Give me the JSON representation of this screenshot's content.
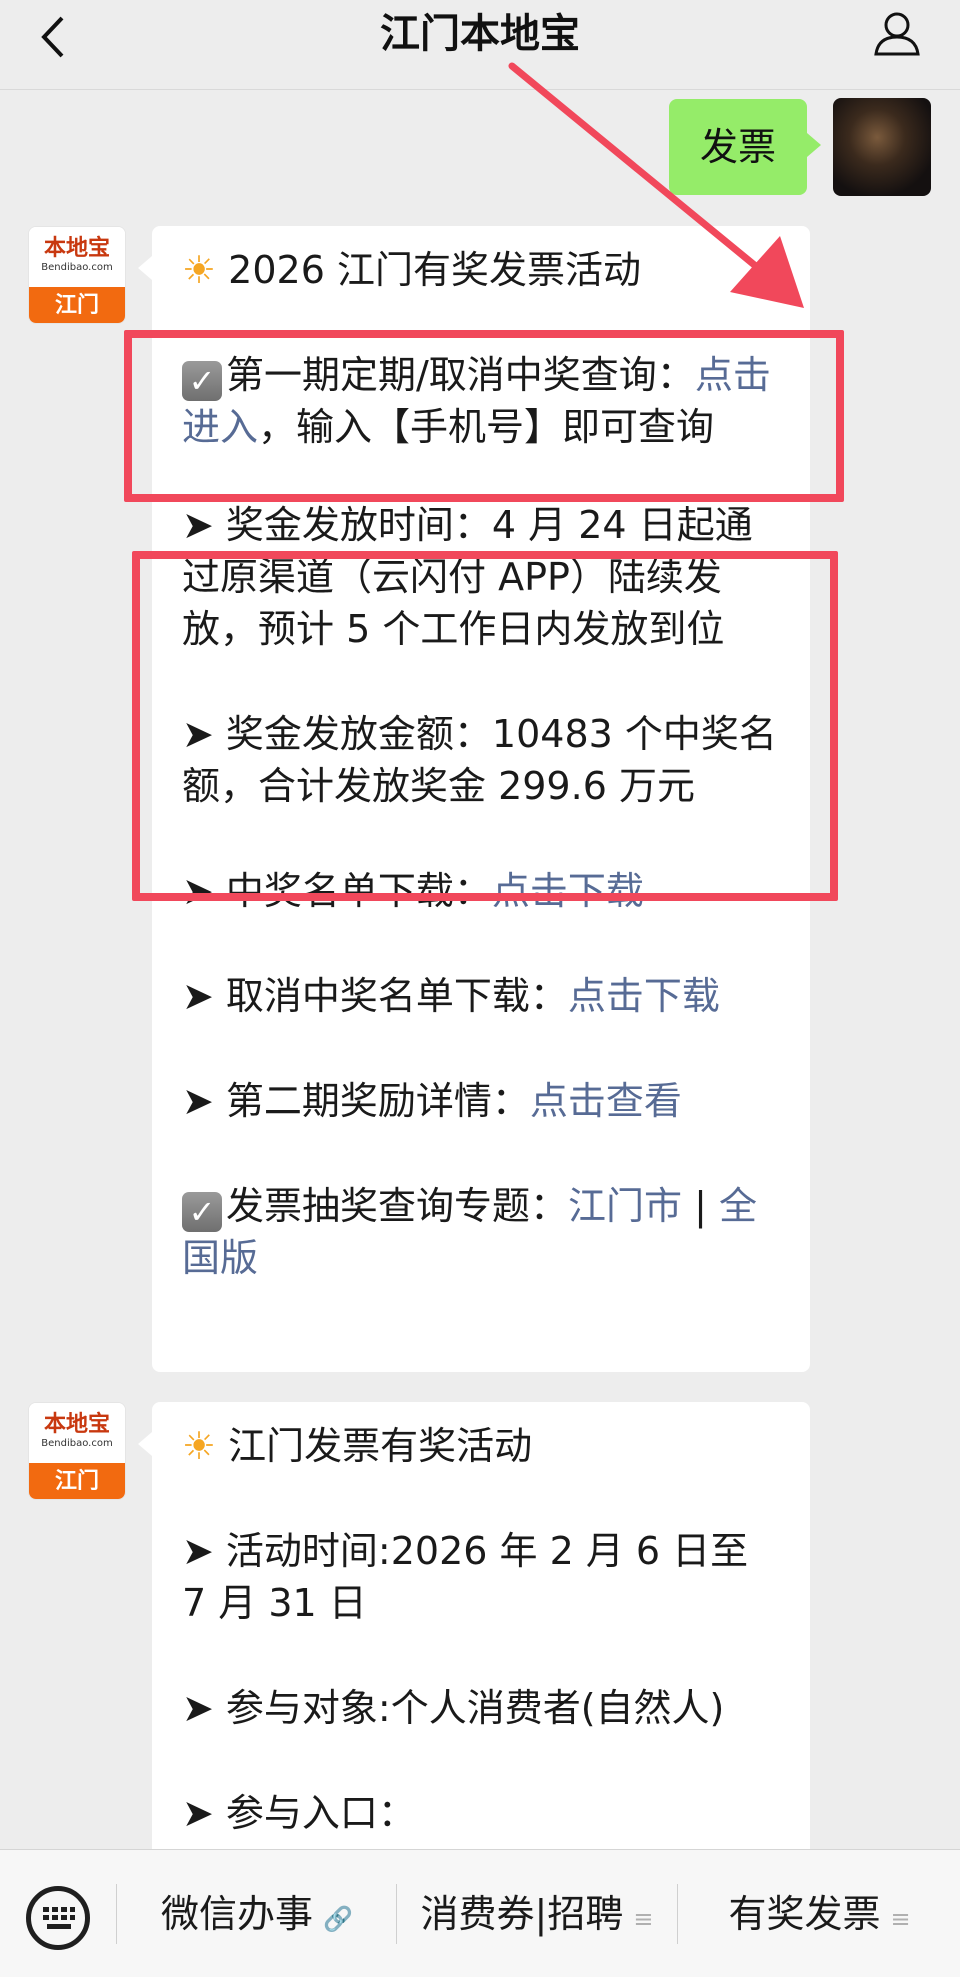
{
  "header": {
    "title": "江门本地宝"
  },
  "sent": {
    "text": "发票"
  },
  "bot": {
    "avatar_name": "本地宝",
    "avatar_sub": "Bendibao.com",
    "avatar_city": "江门"
  },
  "card1": {
    "heading": "2026 江门有奖发票活动",
    "item1_prefix": "第一期定期/取消中奖查询：",
    "item1_link": "点击进入",
    "item1_suffix": "，输入【手机号】即可查询",
    "time_label": "➤ 奖金发放时间：4 月 24 日起通过原渠道（云闪付 APP）陆续发放，预计 5 个工作日内发放到位",
    "amount_label": "➤ 奖金发放金额：10483 个中奖名额，合计发放奖金 299.6 万元",
    "list_download_label": "➤ 中奖名单下载：",
    "list_download_link": "点击下载",
    "cancel_download_label": "➤ 取消中奖名单下载：",
    "cancel_download_link": "点击下载",
    "phase2_label": "➤ 第二期奖励详情：",
    "phase2_link": "点击查看",
    "topic_label": "发票抽奖查询专题：",
    "topic_link_city": "江门市",
    "topic_sep": " | ",
    "topic_link_all": "全国版"
  },
  "card2": {
    "heading": "江门发票有奖活动",
    "time": "➤ 活动时间:2026 年 2 月 6 日至 7 月 31 日",
    "target": "➤ 参与对象:个人消费者(自然人)",
    "entry": "➤ 参与入口："
  },
  "menu": {
    "item1": "微信办事",
    "item2": "消费券|招聘",
    "item3": "有奖发票"
  },
  "colors": {
    "accent_link": "#576b95",
    "bubble_green": "#95ec69",
    "annotation_red": "#f1485b"
  },
  "icons": [
    "back-arrow-icon",
    "user-icon",
    "sun-icon",
    "checkbox-icon",
    "keyboard-icon",
    "link-icon",
    "menu-lines-icon"
  ]
}
